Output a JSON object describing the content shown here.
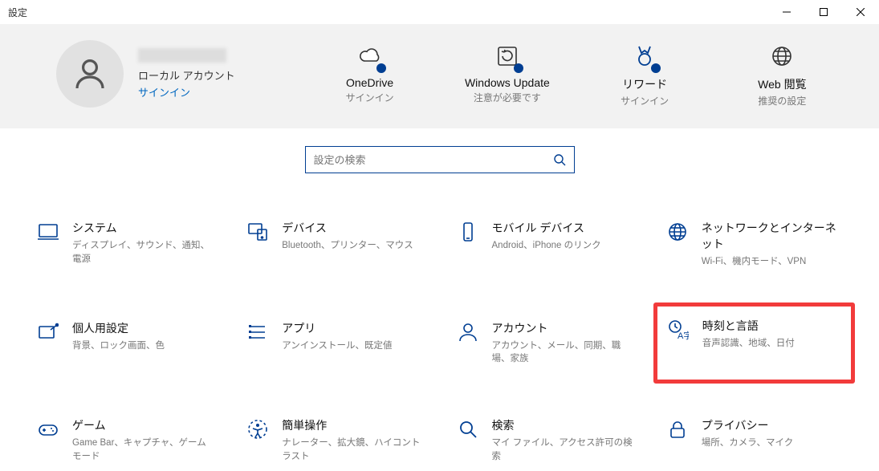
{
  "window": {
    "title": "設定"
  },
  "account": {
    "type_label": "ローカル アカウント",
    "signin_label": "サインイン"
  },
  "banner": {
    "items": [
      {
        "title": "OneDrive",
        "subtitle": "サインイン"
      },
      {
        "title": "Windows Update",
        "subtitle": "注意が必要です"
      },
      {
        "title": "リワード",
        "subtitle": "サインイン"
      },
      {
        "title": "Web 閲覧",
        "subtitle": "推奨の設定"
      }
    ]
  },
  "search": {
    "placeholder": "設定の検索"
  },
  "categories": [
    {
      "title": "システム",
      "subtitle": "ディスプレイ、サウンド、通知、電源"
    },
    {
      "title": "デバイス",
      "subtitle": "Bluetooth、プリンター、マウス"
    },
    {
      "title": "モバイル デバイス",
      "subtitle": "Android、iPhone のリンク"
    },
    {
      "title": "ネットワークとインターネット",
      "subtitle": "Wi-Fi、機内モード、VPN"
    },
    {
      "title": "個人用設定",
      "subtitle": "背景、ロック画面、色"
    },
    {
      "title": "アプリ",
      "subtitle": "アンインストール、既定値"
    },
    {
      "title": "アカウント",
      "subtitle": "アカウント、メール、同期、職場、家族"
    },
    {
      "title": "時刻と言語",
      "subtitle": "音声認識、地域、日付"
    },
    {
      "title": "ゲーム",
      "subtitle": "Game Bar、キャプチャ、ゲーム モード"
    },
    {
      "title": "簡単操作",
      "subtitle": "ナレーター、拡大鏡、ハイコントラスト"
    },
    {
      "title": "検索",
      "subtitle": "マイ ファイル、アクセス許可の検索"
    },
    {
      "title": "プライバシー",
      "subtitle": "場所、カメラ、マイク"
    }
  ]
}
